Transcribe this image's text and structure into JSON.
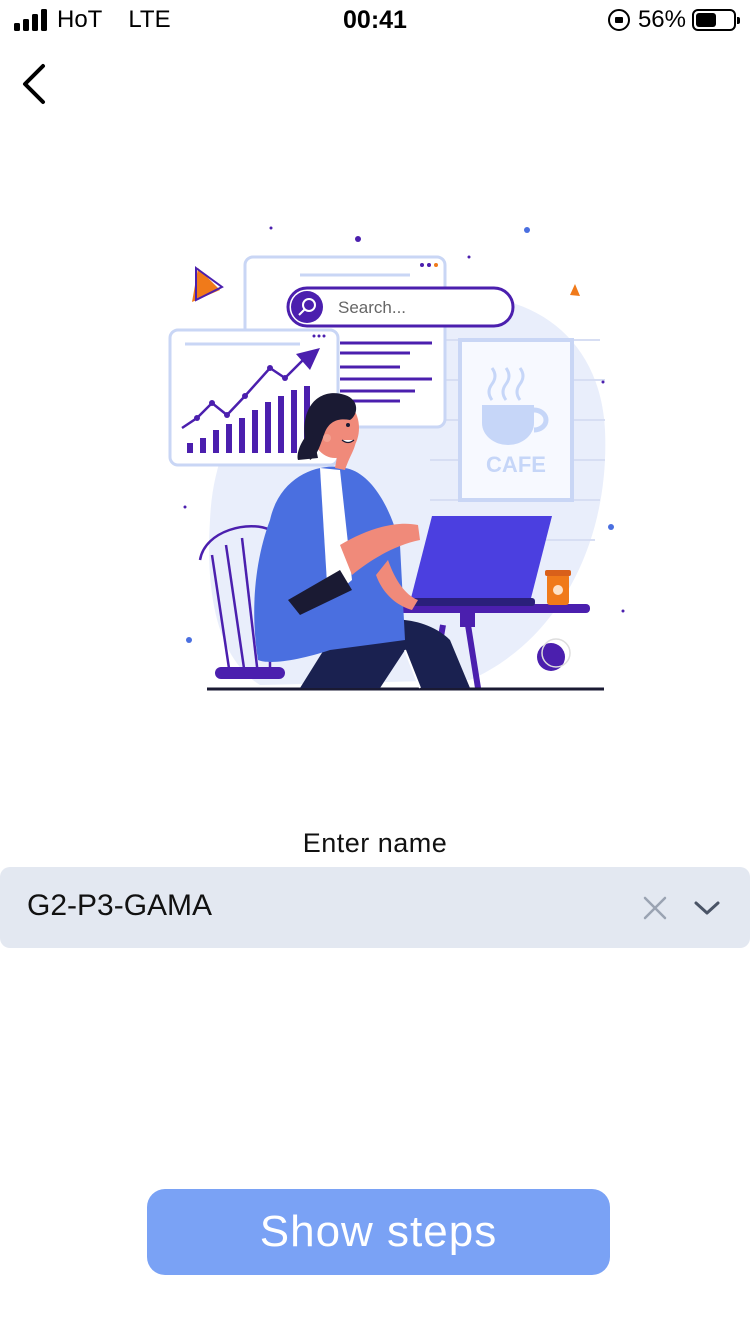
{
  "status_bar": {
    "carrier": "HoT",
    "network": "LTE",
    "time": "00:41",
    "battery_percent": "56%",
    "battery_level": 0.56
  },
  "nav": {
    "back_icon": "chevron-left-icon"
  },
  "illustration": {
    "search_placeholder": "Search...",
    "sign_text": "CAFE"
  },
  "form": {
    "label": "Enter name",
    "value": "G2-P3-GAMA",
    "clear_icon": "close-icon",
    "dropdown_icon": "chevron-down-icon"
  },
  "actions": {
    "primary_label": "Show steps"
  },
  "colors": {
    "accent": "#7aa2f5",
    "field_bg": "#e3e8f1",
    "illustration_purple": "#4b1fae",
    "illustration_blue": "#4a6fe0"
  }
}
